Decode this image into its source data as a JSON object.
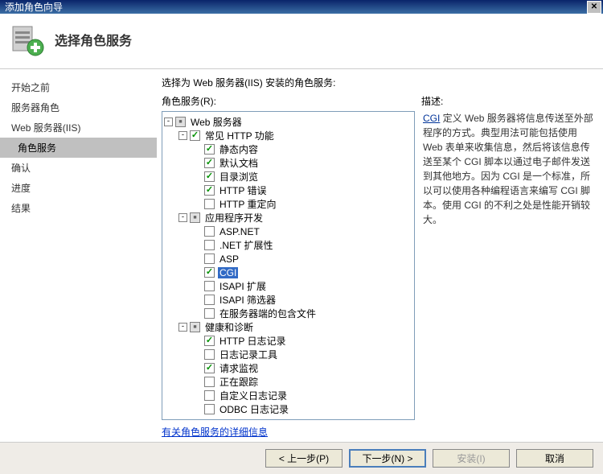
{
  "titlebar": {
    "title": "添加角色向导"
  },
  "header": {
    "title": "选择角色服务"
  },
  "sidebar": {
    "items": [
      {
        "label": "开始之前",
        "indent": false
      },
      {
        "label": "服务器角色",
        "indent": false
      },
      {
        "label": "Web 服务器(IIS)",
        "indent": false
      },
      {
        "label": "角色服务",
        "indent": true,
        "active": true
      },
      {
        "label": "确认",
        "indent": false
      },
      {
        "label": "进度",
        "indent": false
      },
      {
        "label": "结果",
        "indent": false
      }
    ]
  },
  "content": {
    "prompt": "选择为 Web 服务器(IIS) 安装的角色服务:",
    "tree_label": "角色服务(R):",
    "desc_label": "描述:",
    "desc_link": "CGI",
    "desc_text": " 定义 Web 服务器将信息传送至外部程序的方式。典型用法可能包括使用 Web 表单来收集信息，然后将该信息传送至某个 CGI 脚本以通过电子邮件发送到其他地方。因为 CGI 是一个标准，所以可以使用各种编程语言来编写 CGI 脚本。使用 CGI 的不利之处是性能开销较大。",
    "more_link": "有关角色服务的详细信息"
  },
  "tree": [
    {
      "depth": 0,
      "exp": "-",
      "state": "grayed",
      "label": "Web 服务器"
    },
    {
      "depth": 1,
      "exp": "-",
      "state": "checked",
      "label": "常见 HTTP 功能"
    },
    {
      "depth": 2,
      "exp": "",
      "state": "checked",
      "label": "静态内容"
    },
    {
      "depth": 2,
      "exp": "",
      "state": "checked",
      "label": "默认文档"
    },
    {
      "depth": 2,
      "exp": "",
      "state": "checked",
      "label": "目录浏览"
    },
    {
      "depth": 2,
      "exp": "",
      "state": "checked",
      "label": "HTTP 错误"
    },
    {
      "depth": 2,
      "exp": "",
      "state": "unchecked",
      "label": "HTTP 重定向"
    },
    {
      "depth": 1,
      "exp": "-",
      "state": "grayed",
      "label": "应用程序开发"
    },
    {
      "depth": 2,
      "exp": "",
      "state": "unchecked",
      "label": "ASP.NET"
    },
    {
      "depth": 2,
      "exp": "",
      "state": "unchecked",
      "label": ".NET 扩展性"
    },
    {
      "depth": 2,
      "exp": "",
      "state": "unchecked",
      "label": "ASP"
    },
    {
      "depth": 2,
      "exp": "",
      "state": "checked",
      "label": "CGI",
      "selected": true
    },
    {
      "depth": 2,
      "exp": "",
      "state": "unchecked",
      "label": "ISAPI 扩展"
    },
    {
      "depth": 2,
      "exp": "",
      "state": "unchecked",
      "label": "ISAPI 筛选器"
    },
    {
      "depth": 2,
      "exp": "",
      "state": "unchecked",
      "label": "在服务器端的包含文件"
    },
    {
      "depth": 1,
      "exp": "-",
      "state": "grayed",
      "label": "健康和诊断"
    },
    {
      "depth": 2,
      "exp": "",
      "state": "checked",
      "label": "HTTP 日志记录"
    },
    {
      "depth": 2,
      "exp": "",
      "state": "unchecked",
      "label": "日志记录工具"
    },
    {
      "depth": 2,
      "exp": "",
      "state": "checked",
      "label": "请求监视"
    },
    {
      "depth": 2,
      "exp": "",
      "state": "unchecked",
      "label": "正在跟踪"
    },
    {
      "depth": 2,
      "exp": "",
      "state": "unchecked",
      "label": "自定义日志记录"
    },
    {
      "depth": 2,
      "exp": "",
      "state": "unchecked",
      "label": "ODBC 日志记录"
    }
  ],
  "buttons": {
    "prev": "< 上一步(P)",
    "next": "下一步(N) >",
    "install": "安装(I)",
    "cancel": "取消"
  }
}
